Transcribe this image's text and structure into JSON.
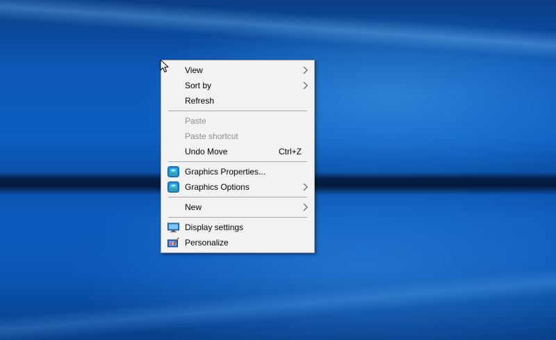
{
  "desktop": {
    "background": "windows-10-hero-wallpaper",
    "accent_color": "#0b5fc2"
  },
  "context_menu": {
    "items": [
      {
        "id": "view",
        "label": "View",
        "submenu": true,
        "enabled": true
      },
      {
        "id": "sort_by",
        "label": "Sort by",
        "submenu": true,
        "enabled": true
      },
      {
        "id": "refresh",
        "label": "Refresh",
        "enabled": true
      },
      {
        "id": "paste",
        "label": "Paste",
        "enabled": false
      },
      {
        "id": "paste_shortcut",
        "label": "Paste shortcut",
        "enabled": false
      },
      {
        "id": "undo_move",
        "label": "Undo Move",
        "shortcut": "Ctrl+Z",
        "enabled": true
      },
      {
        "id": "graphics_properties",
        "label": "Graphics Properties...",
        "icon": "intel-graphics-icon",
        "enabled": true
      },
      {
        "id": "graphics_options",
        "label": "Graphics Options",
        "icon": "intel-graphics-icon",
        "submenu": true,
        "enabled": true
      },
      {
        "id": "new",
        "label": "New",
        "submenu": true,
        "enabled": true
      },
      {
        "id": "display_settings",
        "label": "Display settings",
        "icon": "display-settings-icon",
        "enabled": true
      },
      {
        "id": "personalize",
        "label": "Personalize",
        "icon": "personalize-icon",
        "enabled": true
      }
    ]
  },
  "cursor": {
    "icon": "mouse-pointer-icon"
  }
}
